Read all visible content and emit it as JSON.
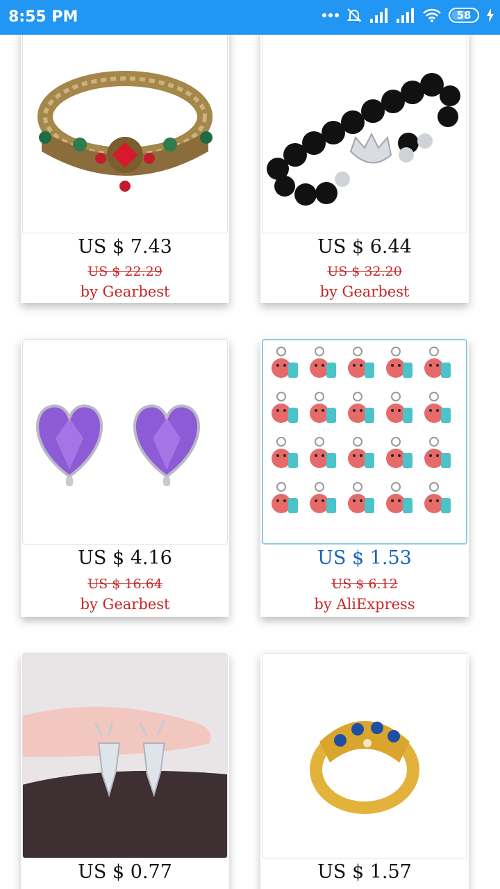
{
  "status_bar": {
    "time": "8:55 PM",
    "battery": "58",
    "icons": [
      "more-dots-icon",
      "alarm-off-icon",
      "signal-icon",
      "signal-icon",
      "wifi-icon",
      "battery-icon",
      "charging-icon"
    ]
  },
  "products": [
    {
      "price": "US $ 7.43",
      "old_price": "US $ 22.29",
      "vendor": "by Gearbest",
      "image": "gold-cuff-bracelet"
    },
    {
      "price": "US $ 6.44",
      "old_price": "US $ 32.20",
      "vendor": "by Gearbest",
      "image": "black-bead-crown-bracelet"
    },
    {
      "price": "US $ 4.16",
      "old_price": "US $ 16.64",
      "vendor": "by Gearbest",
      "image": "purple-heart-earrings"
    },
    {
      "price": "US $ 1.53",
      "old_price": "US $ 6.12",
      "vendor": "by AliExpress",
      "image": "animal-keychains"
    },
    {
      "price": "US $ 0.77",
      "old_price": "",
      "vendor": "",
      "image": "deer-earrings"
    },
    {
      "price": "US $ 1.57",
      "old_price": "",
      "vendor": "",
      "image": "gold-blue-ring"
    }
  ],
  "colors": {
    "status_bar": "#2196f3",
    "sale_red": "#c62828",
    "selected_blue": "#1565c0"
  }
}
